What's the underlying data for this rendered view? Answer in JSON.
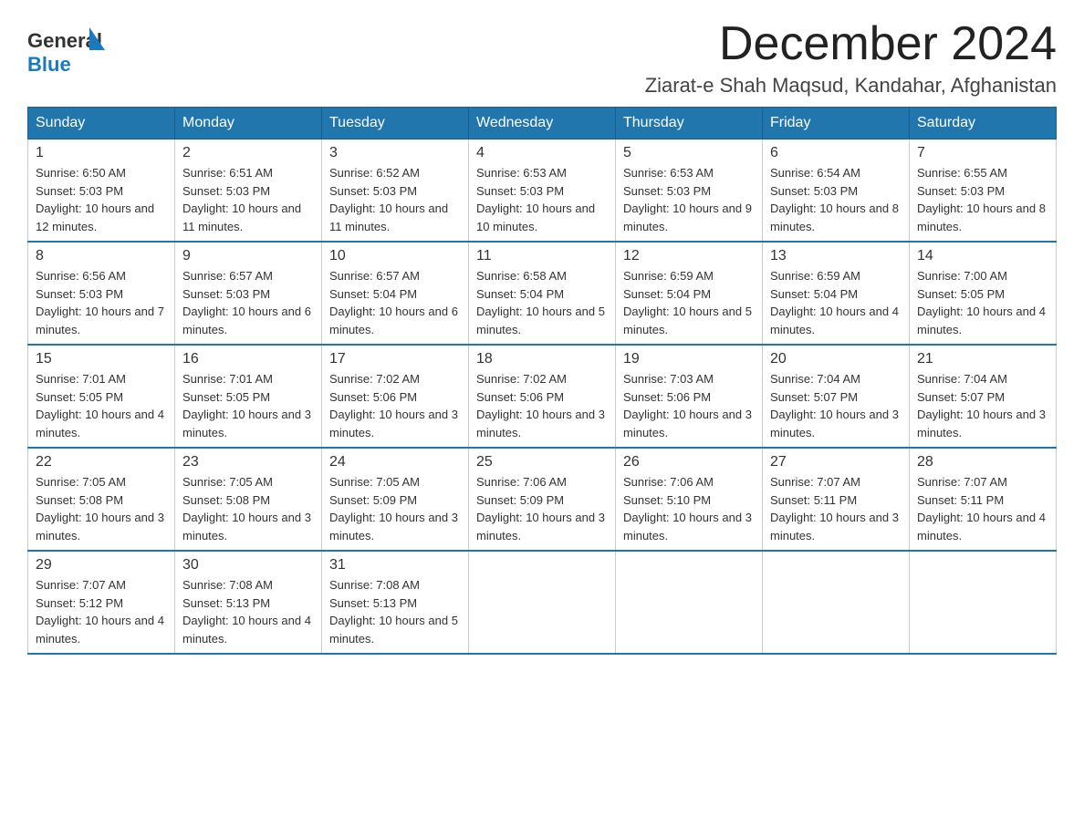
{
  "header": {
    "logo_general": "General",
    "logo_blue": "Blue",
    "month_year": "December 2024",
    "location": "Ziarat-e Shah Maqsud, Kandahar, Afghanistan"
  },
  "days_of_week": [
    "Sunday",
    "Monday",
    "Tuesday",
    "Wednesday",
    "Thursday",
    "Friday",
    "Saturday"
  ],
  "weeks": [
    [
      {
        "day": "1",
        "sunrise": "6:50 AM",
        "sunset": "5:03 PM",
        "daylight": "10 hours and 12 minutes."
      },
      {
        "day": "2",
        "sunrise": "6:51 AM",
        "sunset": "5:03 PM",
        "daylight": "10 hours and 11 minutes."
      },
      {
        "day": "3",
        "sunrise": "6:52 AM",
        "sunset": "5:03 PM",
        "daylight": "10 hours and 11 minutes."
      },
      {
        "day": "4",
        "sunrise": "6:53 AM",
        "sunset": "5:03 PM",
        "daylight": "10 hours and 10 minutes."
      },
      {
        "day": "5",
        "sunrise": "6:53 AM",
        "sunset": "5:03 PM",
        "daylight": "10 hours and 9 minutes."
      },
      {
        "day": "6",
        "sunrise": "6:54 AM",
        "sunset": "5:03 PM",
        "daylight": "10 hours and 8 minutes."
      },
      {
        "day": "7",
        "sunrise": "6:55 AM",
        "sunset": "5:03 PM",
        "daylight": "10 hours and 8 minutes."
      }
    ],
    [
      {
        "day": "8",
        "sunrise": "6:56 AM",
        "sunset": "5:03 PM",
        "daylight": "10 hours and 7 minutes."
      },
      {
        "day": "9",
        "sunrise": "6:57 AM",
        "sunset": "5:03 PM",
        "daylight": "10 hours and 6 minutes."
      },
      {
        "day": "10",
        "sunrise": "6:57 AM",
        "sunset": "5:04 PM",
        "daylight": "10 hours and 6 minutes."
      },
      {
        "day": "11",
        "sunrise": "6:58 AM",
        "sunset": "5:04 PM",
        "daylight": "10 hours and 5 minutes."
      },
      {
        "day": "12",
        "sunrise": "6:59 AM",
        "sunset": "5:04 PM",
        "daylight": "10 hours and 5 minutes."
      },
      {
        "day": "13",
        "sunrise": "6:59 AM",
        "sunset": "5:04 PM",
        "daylight": "10 hours and 4 minutes."
      },
      {
        "day": "14",
        "sunrise": "7:00 AM",
        "sunset": "5:05 PM",
        "daylight": "10 hours and 4 minutes."
      }
    ],
    [
      {
        "day": "15",
        "sunrise": "7:01 AM",
        "sunset": "5:05 PM",
        "daylight": "10 hours and 4 minutes."
      },
      {
        "day": "16",
        "sunrise": "7:01 AM",
        "sunset": "5:05 PM",
        "daylight": "10 hours and 3 minutes."
      },
      {
        "day": "17",
        "sunrise": "7:02 AM",
        "sunset": "5:06 PM",
        "daylight": "10 hours and 3 minutes."
      },
      {
        "day": "18",
        "sunrise": "7:02 AM",
        "sunset": "5:06 PM",
        "daylight": "10 hours and 3 minutes."
      },
      {
        "day": "19",
        "sunrise": "7:03 AM",
        "sunset": "5:06 PM",
        "daylight": "10 hours and 3 minutes."
      },
      {
        "day": "20",
        "sunrise": "7:04 AM",
        "sunset": "5:07 PM",
        "daylight": "10 hours and 3 minutes."
      },
      {
        "day": "21",
        "sunrise": "7:04 AM",
        "sunset": "5:07 PM",
        "daylight": "10 hours and 3 minutes."
      }
    ],
    [
      {
        "day": "22",
        "sunrise": "7:05 AM",
        "sunset": "5:08 PM",
        "daylight": "10 hours and 3 minutes."
      },
      {
        "day": "23",
        "sunrise": "7:05 AM",
        "sunset": "5:08 PM",
        "daylight": "10 hours and 3 minutes."
      },
      {
        "day": "24",
        "sunrise": "7:05 AM",
        "sunset": "5:09 PM",
        "daylight": "10 hours and 3 minutes."
      },
      {
        "day": "25",
        "sunrise": "7:06 AM",
        "sunset": "5:09 PM",
        "daylight": "10 hours and 3 minutes."
      },
      {
        "day": "26",
        "sunrise": "7:06 AM",
        "sunset": "5:10 PM",
        "daylight": "10 hours and 3 minutes."
      },
      {
        "day": "27",
        "sunrise": "7:07 AM",
        "sunset": "5:11 PM",
        "daylight": "10 hours and 3 minutes."
      },
      {
        "day": "28",
        "sunrise": "7:07 AM",
        "sunset": "5:11 PM",
        "daylight": "10 hours and 4 minutes."
      }
    ],
    [
      {
        "day": "29",
        "sunrise": "7:07 AM",
        "sunset": "5:12 PM",
        "daylight": "10 hours and 4 minutes."
      },
      {
        "day": "30",
        "sunrise": "7:08 AM",
        "sunset": "5:13 PM",
        "daylight": "10 hours and 4 minutes."
      },
      {
        "day": "31",
        "sunrise": "7:08 AM",
        "sunset": "5:13 PM",
        "daylight": "10 hours and 5 minutes."
      },
      null,
      null,
      null,
      null
    ]
  ]
}
